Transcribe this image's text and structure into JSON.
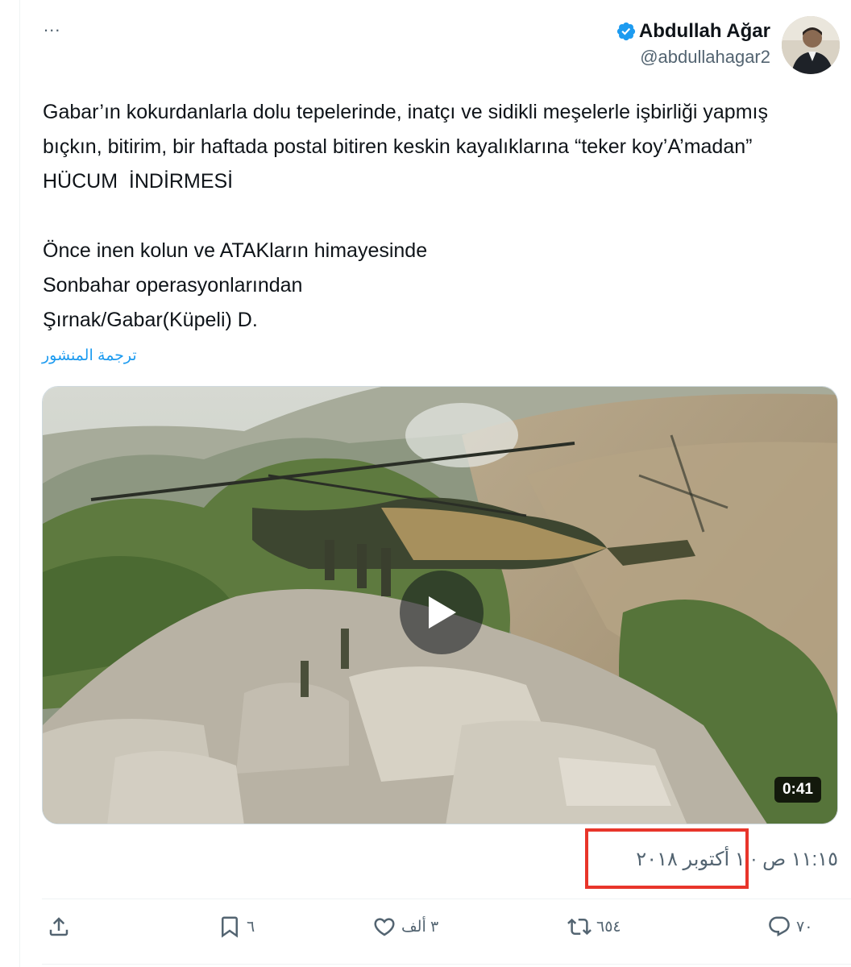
{
  "author": {
    "name": "Abdullah Ağar",
    "handle": "@abdullahagar2",
    "verified": true
  },
  "more_menu_label": "...",
  "tweet": {
    "text": "Gabar’ın kokurdanlarla dolu tepelerinde, inatçı ve sidikli meşelerle işbirliği yapmış bıçkın, bitirim, bir haftada postal bitiren keskin kayalıklarına “teker koy’A’madan” HÜCUM  İNDİRMESİ\n\nÖnce inen kolun ve ATAKların himayesinde\nSonbahar operasyonlarından\nŞırnak/Gabar(Küpeli) D.",
    "translate_label": "ترجمة المنشور",
    "video_duration": "0:41",
    "timestamp": "١١:١٥ ص · ١ أكتوبر ٢٠١٨"
  },
  "actions": {
    "replies": "٧٠",
    "reposts": "٦٥٤",
    "likes": "٣ ألف",
    "bookmarks": "٦"
  },
  "colors": {
    "accent": "#1d9bf0",
    "highlight": "#e8352a",
    "muted_text": "#536471"
  },
  "icons": [
    "verified-icon",
    "avatar",
    "play-icon",
    "reply-icon",
    "repost-icon",
    "like-icon",
    "bookmark-icon",
    "share-icon"
  ]
}
